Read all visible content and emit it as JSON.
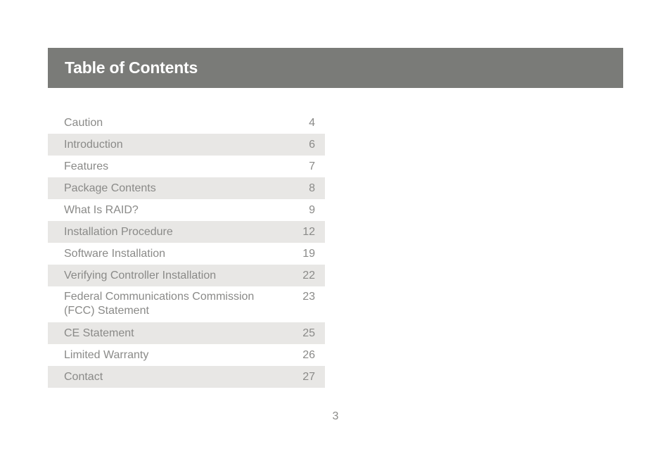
{
  "header": {
    "title": "Table of Contents"
  },
  "toc": [
    {
      "label": "Caution",
      "page": "4"
    },
    {
      "label": "Introduction",
      "page": "6"
    },
    {
      "label": "Features",
      "page": "7"
    },
    {
      "label": "Package Contents",
      "page": "8"
    },
    {
      "label": "What Is RAID?",
      "page": "9"
    },
    {
      "label": "Installation Procedure",
      "page": "12"
    },
    {
      "label": "Software Installation",
      "page": "19"
    },
    {
      "label": "Verifying Controller Installation",
      "page": "22"
    },
    {
      "label": "Federal Communications Commission (FCC) Statement",
      "page": "23"
    },
    {
      "label": "CE Statement",
      "page": "25"
    },
    {
      "label": "Limited Warranty",
      "page": "26"
    },
    {
      "label": "Contact",
      "page": "27"
    }
  ],
  "footer": {
    "page_number": "3"
  }
}
